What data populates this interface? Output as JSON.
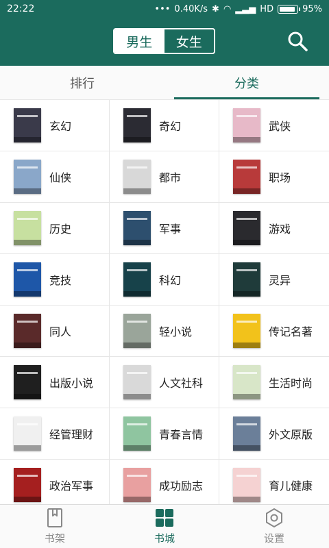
{
  "status": {
    "time": "22:22",
    "net": "0.40K/s",
    "signal": "HD",
    "battery": "95%",
    "dots": "•••"
  },
  "header": {
    "seg_male": "男生",
    "seg_female": "女生",
    "search_icon": "search-icon"
  },
  "tabs": [
    {
      "label": "排行"
    },
    {
      "label": "分类"
    }
  ],
  "categories": [
    {
      "label": "玄幻",
      "color": "#3a3a4a"
    },
    {
      "label": "奇幻",
      "color": "#2b2b33"
    },
    {
      "label": "武侠",
      "color": "#e7b9c8"
    },
    {
      "label": "仙侠",
      "color": "#8aa7c9"
    },
    {
      "label": "都市",
      "color": "#d8d8d8"
    },
    {
      "label": "职场",
      "color": "#b83a3a"
    },
    {
      "label": "历史",
      "color": "#c7e0a0"
    },
    {
      "label": "军事",
      "color": "#2d4f6e"
    },
    {
      "label": "游戏",
      "color": "#2a2a2e"
    },
    {
      "label": "竞技",
      "color": "#1e57a8"
    },
    {
      "label": "科幻",
      "color": "#17424a"
    },
    {
      "label": "灵异",
      "color": "#1f3b3a"
    },
    {
      "label": "同人",
      "color": "#5a2a2a"
    },
    {
      "label": "轻小说",
      "color": "#9aa59a"
    },
    {
      "label": "传记名著",
      "color": "#f2c21b"
    },
    {
      "label": "出版小说",
      "color": "#1f1f1f"
    },
    {
      "label": "人文社科",
      "color": "#d9d9d9"
    },
    {
      "label": "生活时尚",
      "color": "#d8e6c8"
    },
    {
      "label": "经管理财",
      "color": "#f0f0f0"
    },
    {
      "label": "青春言情",
      "color": "#8fc5a0"
    },
    {
      "label": "外文原版",
      "color": "#6b7f99"
    },
    {
      "label": "政治军事",
      "color": "#a51f1f"
    },
    {
      "label": "成功励志",
      "color": "#e8a0a0"
    },
    {
      "label": "育儿健康",
      "color": "#f5d2d2"
    }
  ],
  "nav": [
    {
      "label": "书架",
      "icon": "bookshelf-icon"
    },
    {
      "label": "书城",
      "icon": "bookstore-icon"
    },
    {
      "label": "设置",
      "icon": "settings-icon"
    }
  ],
  "colors": {
    "primary": "#1b6b5d"
  }
}
